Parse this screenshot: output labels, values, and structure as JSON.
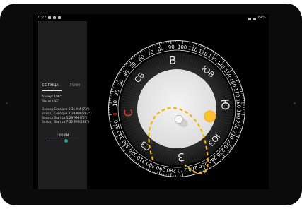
{
  "status_bar": {
    "time": "10:27",
    "battery": "84%"
  },
  "panel": {
    "tabs": [
      {
        "label": "СОЛНЦА",
        "active": true
      },
      {
        "label": "ЛУНЫ",
        "active": false
      }
    ],
    "sun_info": [
      {
        "label": "Азимут",
        "value": "198°"
      },
      {
        "label": "Высота",
        "value": "45°"
      }
    ],
    "events": [
      {
        "label": "Восход",
        "value": "Сегодня 5:31 AM (73°)"
      },
      {
        "label": "Заход",
        "value": "Сегодня 7:38 PM (287°)"
      },
      {
        "label": "Восход",
        "value": "Завтра 5:29 AM (72°)"
      },
      {
        "label": "Заход",
        "value": "Завтра 7:32 PM (288°)"
      }
    ],
    "time_label": "1:00 PM",
    "time_slider_fraction": 0.6
  },
  "compass": {
    "cardinals": [
      "С",
      "СВ",
      "В",
      "ЮВ",
      "Ю",
      "ЮЗ",
      "З",
      "СЗ"
    ],
    "degree_labels": [
      "0",
      "10",
      "20",
      "30",
      "40",
      "50",
      "60",
      "70",
      "80",
      "90",
      "100",
      "110",
      "120",
      "130",
      "140",
      "150",
      "160",
      "170",
      "180",
      "190",
      "200",
      "210",
      "220",
      "230",
      "240",
      "250",
      "260",
      "270",
      "280",
      "290",
      "300",
      "310",
      "320",
      "330",
      "340",
      "350"
    ],
    "heading_deg": 95,
    "sun_azimuth_deg": 198,
    "sun_altitude_deg": 45,
    "north_color": "#e53935",
    "sun_color": "#fbc02d",
    "path_color": "#f5b400"
  }
}
